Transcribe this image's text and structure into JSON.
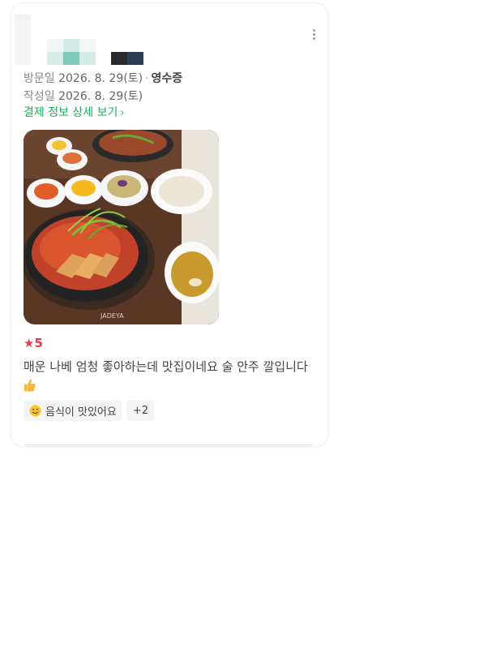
{
  "review": {
    "visit_label": "방문일",
    "visit_date": "2026. 8. 29(토)",
    "separator": "·",
    "receipt_type": "영수증",
    "write_label": "작성일",
    "write_date": "2026. 8. 29(토)",
    "payment_link": "결제 정보 상세 보기",
    "rating": "5",
    "text": "매운 나베 엄청 좋아하는데 맛집이네요 술 안주 깔입니다",
    "tags": [
      {
        "label": "음식이 맛있어요",
        "icon": "yum-face-icon"
      },
      {
        "label": "+2"
      }
    ],
    "photo_watermark": "JADEYA"
  },
  "colors": {
    "accent_green": "#1db162",
    "rating_red": "#f0394e",
    "tag_bg": "#f4f4f4"
  }
}
